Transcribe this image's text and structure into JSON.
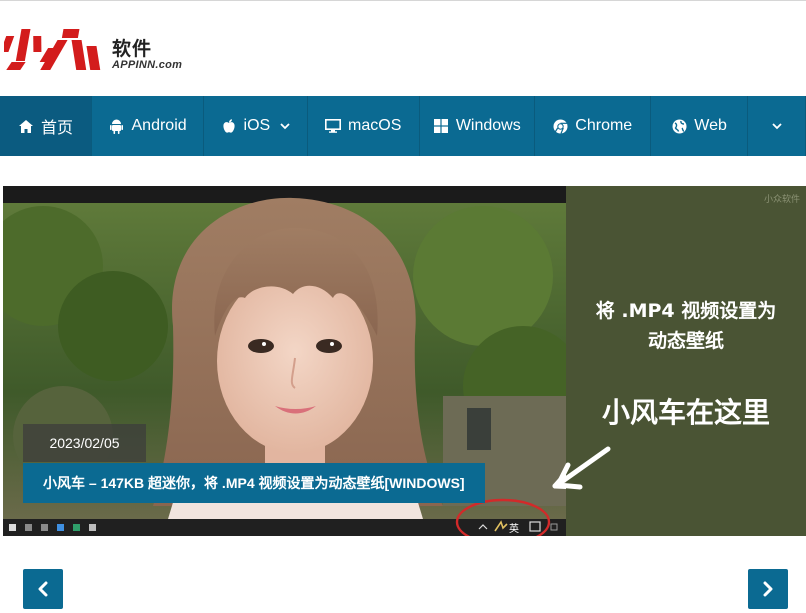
{
  "logo": {
    "cn": "软件",
    "en": "APPINN.com",
    "mark_text": "小众"
  },
  "nav": {
    "items": [
      {
        "label": "首页",
        "icon": "home-icon",
        "active": true
      },
      {
        "label": "Android",
        "icon": "android-icon"
      },
      {
        "label": "iOS",
        "icon": "apple-icon",
        "dropdown": true
      },
      {
        "label": "macOS",
        "icon": "monitor-icon"
      },
      {
        "label": "Windows",
        "icon": "windows-icon"
      },
      {
        "label": "Chrome",
        "icon": "chrome-icon"
      },
      {
        "label": "Web",
        "icon": "globe-icon"
      }
    ]
  },
  "slider": {
    "date": "2023/02/05",
    "title": "小风车 – 147KB 超迷你，将 .MP4 视频设置为动态壁纸[WINDOWS]",
    "image_text_1": "将 .MP4 视频设置为",
    "image_text_2": "动态壁纸",
    "image_text_3": "小风车在这里",
    "watermark": "小众软件",
    "tray_lang": "英"
  },
  "colors": {
    "accent": "#0b6a92",
    "logo_red": "#d31c1c"
  }
}
